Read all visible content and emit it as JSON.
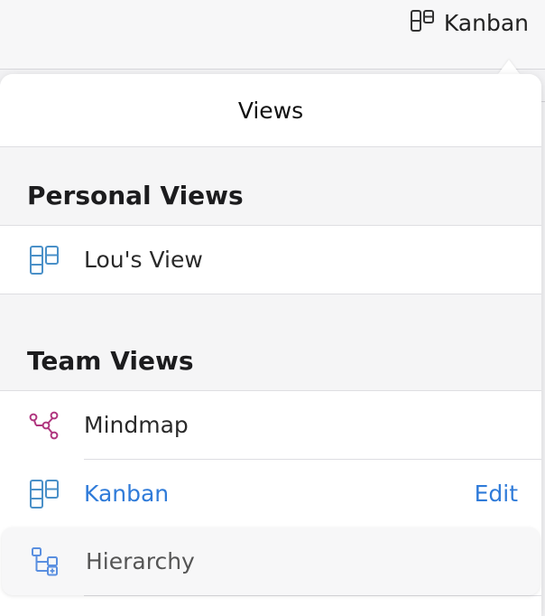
{
  "topbar": {
    "current_view_label": "Kanban",
    "current_view_icon": "kanban-icon"
  },
  "popover": {
    "title": "Views",
    "sections": [
      {
        "title": "Personal Views",
        "items": [
          {
            "label": "Lou's View",
            "icon": "kanban-icon"
          }
        ]
      },
      {
        "title": "Team Views",
        "items": [
          {
            "label": "Mindmap",
            "icon": "mindmap-icon"
          },
          {
            "label": "Kanban",
            "icon": "kanban-icon",
            "selected": true,
            "action_label": "Edit"
          },
          {
            "label": "Hierarchy",
            "icon": "hierarchy-icon",
            "hovered": true
          }
        ]
      }
    ]
  },
  "colors": {
    "accent_blue": "#2f7bd9",
    "kanban_icon_blue": "#4a90c8",
    "mindmap_icon_magenta": "#b0367f",
    "hierarchy_icon_blue": "#5a8fe0"
  }
}
